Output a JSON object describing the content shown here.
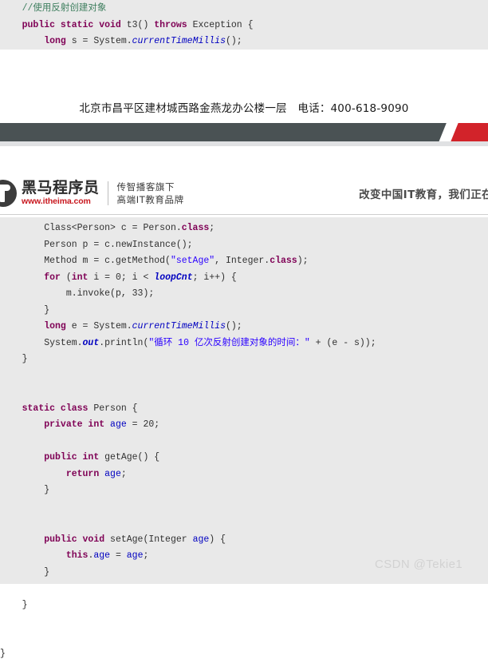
{
  "top_code": {
    "lines": [
      [
        {
          "t": "    ",
          "c": "plain"
        },
        {
          "t": "//使用反射创建对象",
          "c": "cmt"
        }
      ],
      [
        {
          "t": "    ",
          "c": "plain"
        },
        {
          "t": "public static void",
          "c": "kw"
        },
        {
          "t": " t3() ",
          "c": "plain"
        },
        {
          "t": "throws",
          "c": "kw"
        },
        {
          "t": " Exception {",
          "c": "plain"
        }
      ],
      [
        {
          "t": "        ",
          "c": "plain"
        },
        {
          "t": "long",
          "c": "kw"
        },
        {
          "t": " s = System.",
          "c": "plain"
        },
        {
          "t": "currentTimeMillis",
          "c": "stfld"
        },
        {
          "t": "();",
          "c": "plain"
        }
      ]
    ]
  },
  "address": {
    "text": "北京市昌平区建材城西路金燕龙办公楼一层　电话：400-618-9090"
  },
  "brand": {
    "logo_name": "黑马程序员",
    "logo_url": "www.itheima.com",
    "tagline_line1": "传智播客旗下",
    "tagline_line2": "高端IT教育品牌",
    "slogan": "改变中国IT教育，我们正在"
  },
  "main_code": {
    "lines": [
      [
        {
          "t": "        ",
          "c": "plain"
        },
        {
          "t": "Class<Person> c = Person.",
          "c": "plain"
        },
        {
          "t": "class",
          "c": "kw"
        },
        {
          "t": ";",
          "c": "plain"
        }
      ],
      [
        {
          "t": "        ",
          "c": "plain"
        },
        {
          "t": "Person p = c.newInstance();",
          "c": "plain"
        }
      ],
      [
        {
          "t": "        ",
          "c": "plain"
        },
        {
          "t": "Method m = c.getMethod(",
          "c": "plain"
        },
        {
          "t": "\"setAge\"",
          "c": "str"
        },
        {
          "t": ", Integer.",
          "c": "plain"
        },
        {
          "t": "class",
          "c": "kw"
        },
        {
          "t": ");",
          "c": "plain"
        }
      ],
      [
        {
          "t": "        ",
          "c": "plain"
        },
        {
          "t": "for",
          "c": "kw"
        },
        {
          "t": " (",
          "c": "plain"
        },
        {
          "t": "int",
          "c": "kw"
        },
        {
          "t": " i = 0; i < ",
          "c": "plain"
        },
        {
          "t": "loopCnt",
          "c": "stfld-b"
        },
        {
          "t": "; i++) {",
          "c": "plain"
        }
      ],
      [
        {
          "t": "            ",
          "c": "plain"
        },
        {
          "t": "m.invoke(p, 33);",
          "c": "plain"
        }
      ],
      [
        {
          "t": "        ",
          "c": "plain"
        },
        {
          "t": "}",
          "c": "plain"
        }
      ],
      [
        {
          "t": "        ",
          "c": "plain"
        },
        {
          "t": "long",
          "c": "kw"
        },
        {
          "t": " e = System.",
          "c": "plain"
        },
        {
          "t": "currentTimeMillis",
          "c": "stfld"
        },
        {
          "t": "();",
          "c": "plain"
        }
      ],
      [
        {
          "t": "        ",
          "c": "plain"
        },
        {
          "t": "System.",
          "c": "plain"
        },
        {
          "t": "out",
          "c": "stfld-b"
        },
        {
          "t": ".println(",
          "c": "plain"
        },
        {
          "t": "\"循环 10 亿次反射创建对象的时间：\"",
          "c": "str"
        },
        {
          "t": " + (e - s));",
          "c": "plain"
        }
      ],
      [
        {
          "t": "    ",
          "c": "plain"
        },
        {
          "t": "}",
          "c": "plain"
        }
      ],
      [
        {
          "t": "",
          "c": "plain"
        }
      ],
      [
        {
          "t": "",
          "c": "plain"
        }
      ],
      [
        {
          "t": "    ",
          "c": "plain"
        },
        {
          "t": "static class",
          "c": "kw"
        },
        {
          "t": " Person {",
          "c": "plain"
        }
      ],
      [
        {
          "t": "        ",
          "c": "plain"
        },
        {
          "t": "private int",
          "c": "kw"
        },
        {
          "t": " ",
          "c": "plain"
        },
        {
          "t": "age",
          "c": "fld"
        },
        {
          "t": " = 20;",
          "c": "plain"
        }
      ],
      [
        {
          "t": "",
          "c": "plain"
        }
      ],
      [
        {
          "t": "        ",
          "c": "plain"
        },
        {
          "t": "public int",
          "c": "kw"
        },
        {
          "t": " getAge() {",
          "c": "plain"
        }
      ],
      [
        {
          "t": "            ",
          "c": "plain"
        },
        {
          "t": "return",
          "c": "kw"
        },
        {
          "t": " ",
          "c": "plain"
        },
        {
          "t": "age",
          "c": "fld"
        },
        {
          "t": ";",
          "c": "plain"
        }
      ],
      [
        {
          "t": "        ",
          "c": "plain"
        },
        {
          "t": "}",
          "c": "plain"
        }
      ],
      [
        {
          "t": "",
          "c": "plain"
        }
      ],
      [
        {
          "t": "",
          "c": "plain"
        }
      ],
      [
        {
          "t": "        ",
          "c": "plain"
        },
        {
          "t": "public void",
          "c": "kw"
        },
        {
          "t": " setAge(Integer ",
          "c": "plain"
        },
        {
          "t": "age",
          "c": "fld"
        },
        {
          "t": ") {",
          "c": "plain"
        }
      ],
      [
        {
          "t": "            ",
          "c": "plain"
        },
        {
          "t": "this",
          "c": "kw"
        },
        {
          "t": ".",
          "c": "plain"
        },
        {
          "t": "age",
          "c": "fld"
        },
        {
          "t": " = ",
          "c": "plain"
        },
        {
          "t": "age",
          "c": "fld"
        },
        {
          "t": ";",
          "c": "plain"
        }
      ],
      [
        {
          "t": "        ",
          "c": "plain"
        },
        {
          "t": "}",
          "c": "plain"
        }
      ],
      [
        {
          "t": "",
          "c": "plain"
        }
      ],
      [
        {
          "t": "    ",
          "c": "plain"
        },
        {
          "t": "}",
          "c": "plain"
        }
      ],
      [
        {
          "t": "",
          "c": "plain"
        }
      ],
      [
        {
          "t": "",
          "c": "plain"
        }
      ],
      [
        {
          "t": "}",
          "c": "plain"
        }
      ]
    ]
  },
  "watermark": {
    "text": "CSDN @Tekie1"
  },
  "colors": {
    "code_background": "#e9e9e9",
    "keyword": "#7f0055",
    "string": "#2a00ff",
    "comment": "#3f7f5f",
    "field": "#0000c0",
    "banner_dark": "#4a5254",
    "banner_red": "#d2232a",
    "brand_red": "#c8171e",
    "watermark": "#d2d2d2"
  }
}
